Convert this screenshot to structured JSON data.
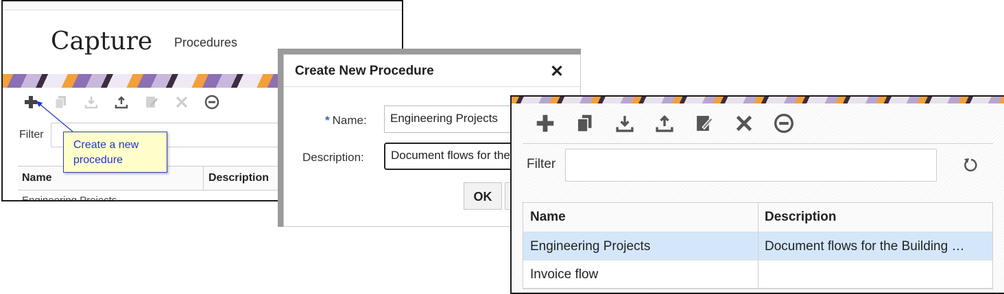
{
  "capture_panel": {
    "app_title": "Capture",
    "nav_item": "Procedures",
    "filter_label": "Filter",
    "columns": [
      "Name",
      "Description"
    ],
    "first_row_name": "Engineering Projects",
    "toolbar_icons": [
      "add-icon",
      "copy-icon",
      "download-icon",
      "upload-icon",
      "edit-icon",
      "delete-icon",
      "circle-user-icon"
    ],
    "callout_text": "Create a new procedure"
  },
  "dialog": {
    "title": "Create New Procedure",
    "close_glyph": "✕",
    "required_marker": "*",
    "name_label": "Name:",
    "name_value": "Engineering Projects",
    "description_label": "Description:",
    "description_value": "Document flows for the",
    "ok_label": "OK"
  },
  "procedures_panel": {
    "filter_label": "Filter",
    "columns": [
      "Name",
      "Description"
    ],
    "rows": [
      {
        "name": "Engineering Projects",
        "description": "Document flows for the Building …",
        "selected": true
      },
      {
        "name": "Invoice flow",
        "description": "",
        "selected": false
      }
    ],
    "toolbar_icons": [
      "add-icon",
      "copy-icon",
      "download-icon",
      "upload-icon",
      "edit-icon",
      "delete-icon",
      "circle-user-icon"
    ],
    "selected_row_color": "#d4e7fa"
  }
}
